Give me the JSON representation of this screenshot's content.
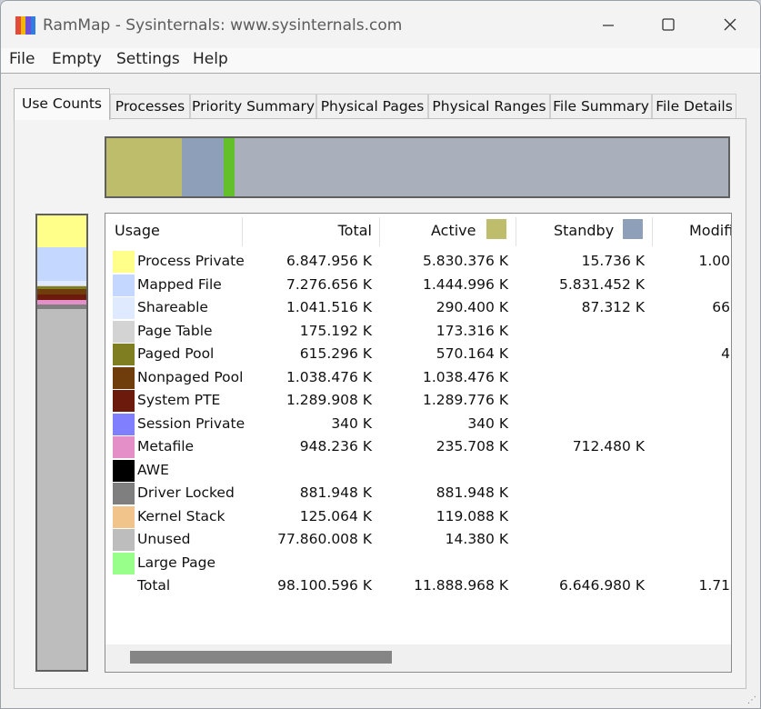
{
  "window": {
    "title": "RamMap - Sysinternals: www.sysinternals.com",
    "icon_colors": [
      "#e34a3a",
      "#f0b800",
      "#6b4fd8",
      "#2f7de1"
    ]
  },
  "menu": [
    "File",
    "Empty",
    "Settings",
    "Help"
  ],
  "tabs": [
    "Use Counts",
    "Processes",
    "Priority Summary",
    "Physical Pages",
    "Physical Ranges",
    "File Summary",
    "File Details"
  ],
  "active_tab": "Use Counts",
  "columns": {
    "usage": "Usage",
    "total": "Total",
    "active": "Active",
    "standby": "Standby",
    "modified": "Modifi"
  },
  "column_colors": {
    "active": "#bdbd6b",
    "standby": "#8e9fba"
  },
  "rows": [
    {
      "name": "Process Private",
      "color": "#ffff8a",
      "total": "6.847.956 K",
      "active": "5.830.376 K",
      "standby": "15.736 K",
      "modified": "1.00"
    },
    {
      "name": "Mapped File",
      "color": "#c3d7ff",
      "total": "7.276.656 K",
      "active": "1.444.996 K",
      "standby": "5.831.452 K",
      "modified": ""
    },
    {
      "name": "Shareable",
      "color": "#dfe9ff",
      "total": "1.041.516 K",
      "active": "290.400 K",
      "standby": "87.312 K",
      "modified": "66"
    },
    {
      "name": "Page Table",
      "color": "#d3d3d3",
      "total": "175.192 K",
      "active": "173.316 K",
      "standby": "",
      "modified": ""
    },
    {
      "name": "Paged Pool",
      "color": "#7f7f21",
      "total": "615.296 K",
      "active": "570.164 K",
      "standby": "",
      "modified": "4"
    },
    {
      "name": "Nonpaged Pool",
      "color": "#6e3d0b",
      "total": "1.038.476 K",
      "active": "1.038.476 K",
      "standby": "",
      "modified": ""
    },
    {
      "name": "System PTE",
      "color": "#6b1a0c",
      "total": "1.289.908 K",
      "active": "1.289.776 K",
      "standby": "",
      "modified": ""
    },
    {
      "name": "Session Private",
      "color": "#8080ff",
      "total": "340 K",
      "active": "340 K",
      "standby": "",
      "modified": ""
    },
    {
      "name": "Metafile",
      "color": "#e58fc8",
      "total": "948.236 K",
      "active": "235.708 K",
      "standby": "712.480 K",
      "modified": ""
    },
    {
      "name": "AWE",
      "color": "#000000",
      "total": "",
      "active": "",
      "standby": "",
      "modified": ""
    },
    {
      "name": "Driver Locked",
      "color": "#7f7f7f",
      "total": "881.948 K",
      "active": "881.948 K",
      "standby": "",
      "modified": ""
    },
    {
      "name": "Kernel Stack",
      "color": "#f0c48a",
      "total": "125.064 K",
      "active": "119.088 K",
      "standby": "",
      "modified": ""
    },
    {
      "name": "Unused",
      "color": "#bdbdbd",
      "total": "77.860.008 K",
      "active": "14.380 K",
      "standby": "",
      "modified": ""
    },
    {
      "name": "Large Page",
      "color": "#98ff8a",
      "total": "",
      "active": "",
      "standby": "",
      "modified": ""
    },
    {
      "name": "Total",
      "color": "",
      "total": "98.100.596 K",
      "active": "11.888.968 K",
      "standby": "6.646.980 K",
      "modified": "1.71"
    }
  ],
  "top_bar_segments": [
    {
      "name": "active",
      "color": "#bdbd6b",
      "fraction": 0.121
    },
    {
      "name": "standby",
      "color": "#8e9fba",
      "fraction": 0.0675
    },
    {
      "name": "modified",
      "color": "#63c02a",
      "fraction": 0.0175
    },
    {
      "name": "free",
      "color": "#a9b0bb",
      "fraction": 0.794
    }
  ],
  "side_bar_segments": [
    {
      "name": "process-private",
      "color": "#ffff8a",
      "fraction": 0.0698
    },
    {
      "name": "mapped-file",
      "color": "#c3d7ff",
      "fraction": 0.0742
    },
    {
      "name": "shareable",
      "color": "#dfe9ff",
      "fraction": 0.0106
    },
    {
      "name": "page-table",
      "color": "#d3d3d3",
      "fraction": 0.0018
    },
    {
      "name": "paged-pool",
      "color": "#7f7f21",
      "fraction": 0.0063
    },
    {
      "name": "nonpaged-pool",
      "color": "#6e3d0b",
      "fraction": 0.0106
    },
    {
      "name": "system-pte",
      "color": "#6b1a0c",
      "fraction": 0.0131
    },
    {
      "name": "metafile",
      "color": "#e58fc8",
      "fraction": 0.0097
    },
    {
      "name": "driver-locked",
      "color": "#7f7f7f",
      "fraction": 0.009
    },
    {
      "name": "kernel-stack",
      "color": "#f0c48a",
      "fraction": 0.0013
    },
    {
      "name": "unused",
      "color": "#bdbdbd",
      "fraction": 0.7937
    }
  ],
  "icons": {
    "minimize": "minimize-icon",
    "maximize": "maximize-icon",
    "close": "close-icon",
    "app": "rammap-app-icon"
  }
}
